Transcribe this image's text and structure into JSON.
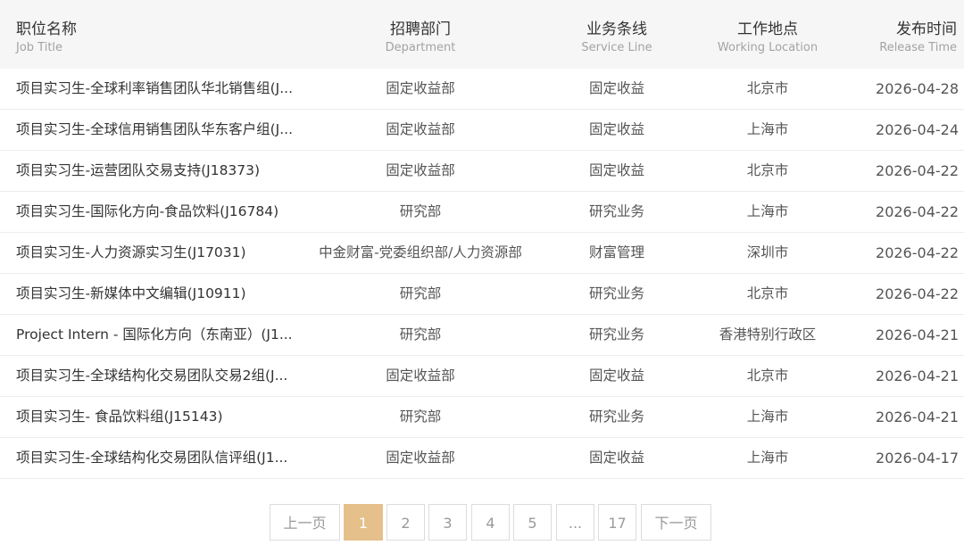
{
  "header": {
    "title": {
      "cn": "职位名称",
      "en": "Job Title"
    },
    "department": {
      "cn": "招聘部门",
      "en": "Department"
    },
    "service_line": {
      "cn": "业务条线",
      "en": "Service Line"
    },
    "location": {
      "cn": "工作地点",
      "en": "Working Location"
    },
    "release": {
      "cn": "发布时间",
      "en": "Release Time"
    }
  },
  "rows": [
    {
      "title": "项目实习生-全球利率销售团队华北销售组(J...",
      "department": "固定收益部",
      "service_line": "固定收益",
      "location": "北京市",
      "date": "2026-04-28"
    },
    {
      "title": "项目实习生-全球信用销售团队华东客户组(J...",
      "department": "固定收益部",
      "service_line": "固定收益",
      "location": "上海市",
      "date": "2026-04-24"
    },
    {
      "title": "项目实习生-运营团队交易支持(J18373)",
      "department": "固定收益部",
      "service_line": "固定收益",
      "location": "北京市",
      "date": "2026-04-22"
    },
    {
      "title": "项目实习生-国际化方向-食品饮料(J16784)",
      "department": "研究部",
      "service_line": "研究业务",
      "location": "上海市",
      "date": "2026-04-22"
    },
    {
      "title": "项目实习生-人力资源实习生(J17031)",
      "department": "中金财富-党委组织部/人力资源部",
      "service_line": "财富管理",
      "location": "深圳市",
      "date": "2026-04-22"
    },
    {
      "title": "项目实习生-新媒体中文编辑(J10911)",
      "department": "研究部",
      "service_line": "研究业务",
      "location": "北京市",
      "date": "2026-04-22"
    },
    {
      "title": "Project Intern - 国际化方向（东南亚）(J1...",
      "department": "研究部",
      "service_line": "研究业务",
      "location": "香港特别行政区",
      "date": "2026-04-21"
    },
    {
      "title": "项目实习生-全球结构化交易团队交易2组(J...",
      "department": "固定收益部",
      "service_line": "固定收益",
      "location": "北京市",
      "date": "2026-04-21"
    },
    {
      "title": "项目实习生- 食品饮料组(J15143)",
      "department": "研究部",
      "service_line": "研究业务",
      "location": "上海市",
      "date": "2026-04-21"
    },
    {
      "title": "项目实习生-全球结构化交易团队信评组(J1...",
      "department": "固定收益部",
      "service_line": "固定收益",
      "location": "上海市",
      "date": "2026-04-17"
    }
  ],
  "pagination": {
    "prev": "上一页",
    "pages": [
      "1",
      "2",
      "3",
      "4",
      "5",
      "...",
      "17"
    ],
    "current": "1",
    "next": "下一页"
  },
  "colors": {
    "accent": "#e5c08a",
    "header_bg": "#f6f6f6"
  }
}
